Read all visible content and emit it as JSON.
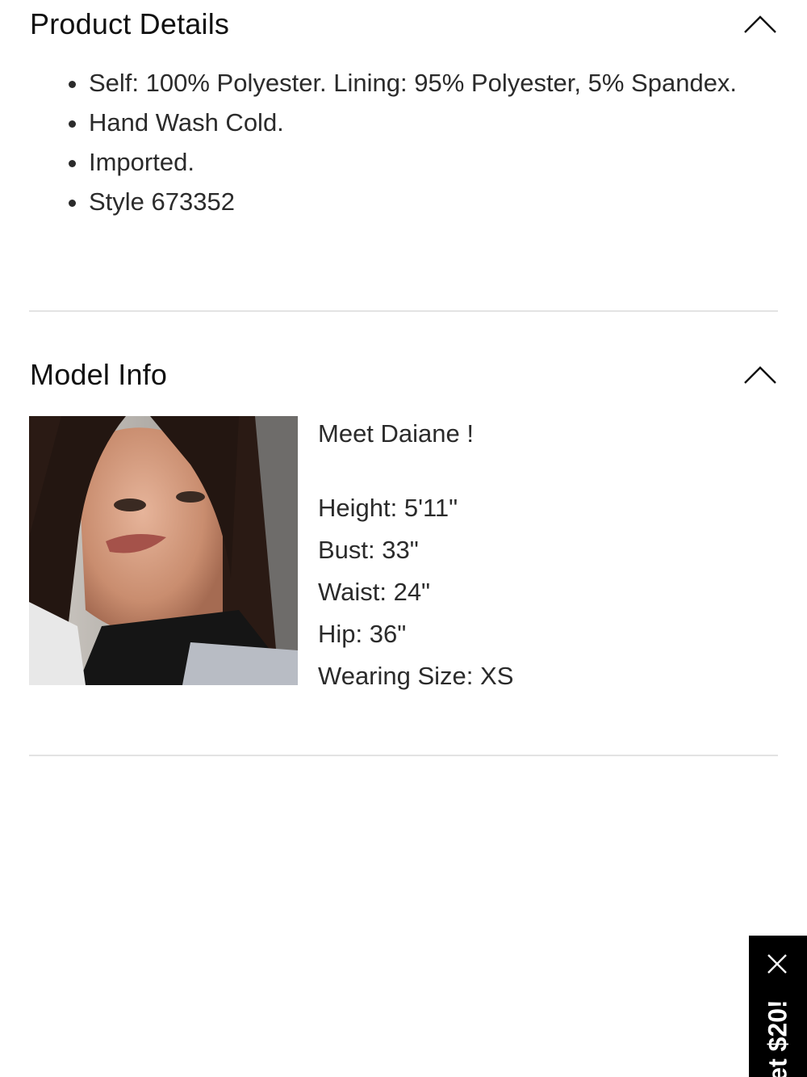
{
  "product_details": {
    "title": "Product Details",
    "items": [
      "Self: 100% Polyester. Lining: 95% Polyester, 5% Spandex.",
      "Hand Wash Cold.",
      "Imported.",
      "Style 673352"
    ],
    "toggle_icon": "chevron-up-icon"
  },
  "model_info": {
    "title": "Model Info",
    "toggle_icon": "chevron-up-icon",
    "greeting": "Meet Daiane !",
    "stats": [
      "Height: 5'11\"",
      "Bust: 33\"",
      "Waist: 24\"",
      "Hip: 36\"",
      "Wearing Size: XS"
    ]
  },
  "promo": {
    "text": "et $20!",
    "close_icon": "close-icon"
  },
  "colors": {
    "divider": "#e3e3e3",
    "promo_bg": "#000000",
    "text": "#2b2b2b"
  }
}
